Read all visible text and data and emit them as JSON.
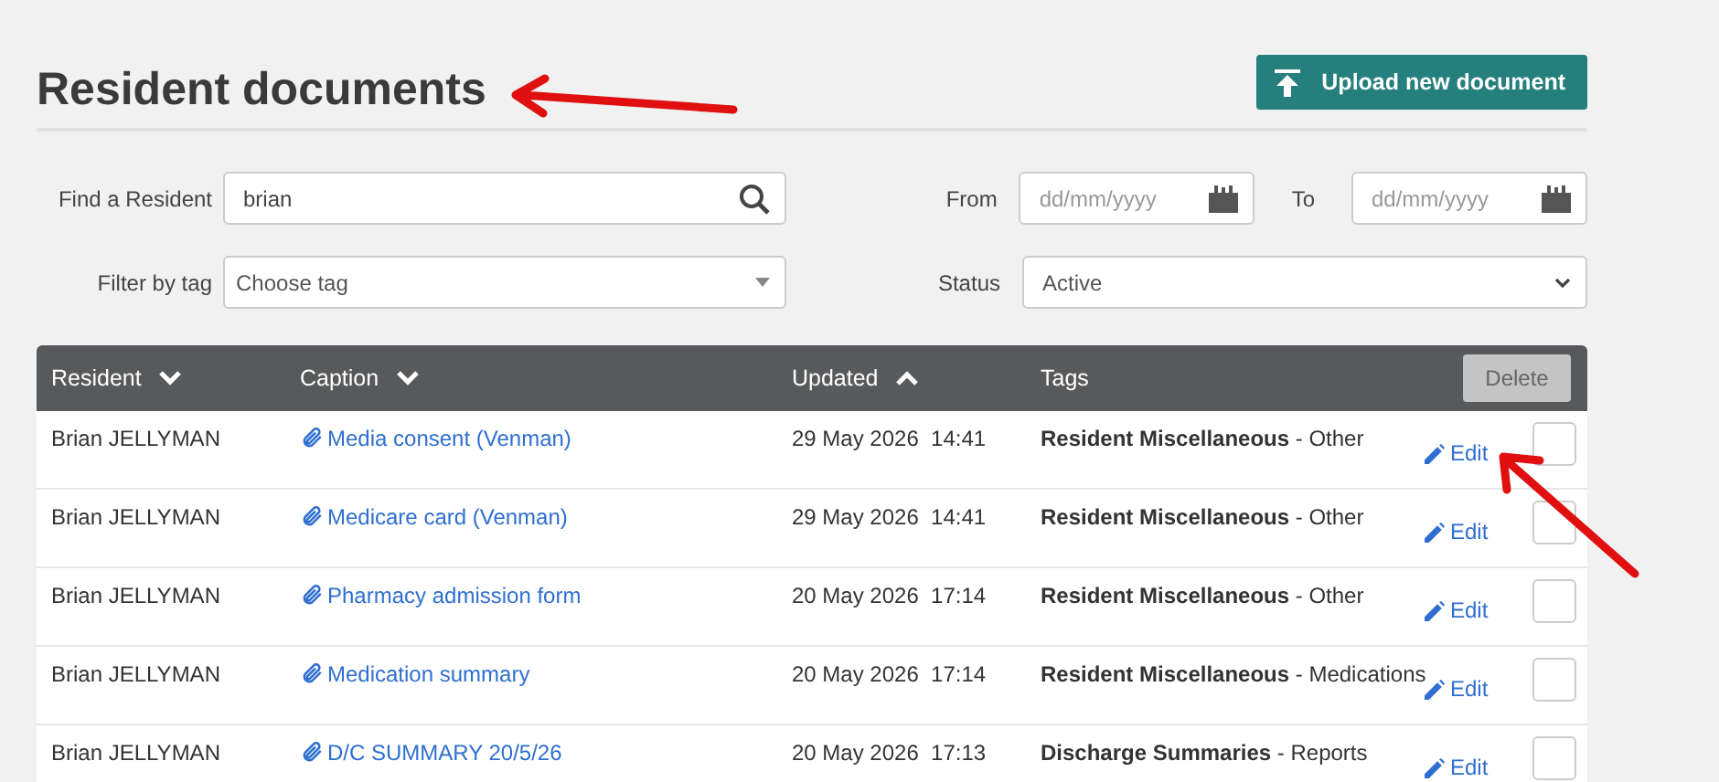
{
  "title": "Resident documents",
  "upload_button": {
    "label": "Upload new document"
  },
  "filters": {
    "find_resident": {
      "label": "Find a Resident",
      "value": "brian"
    },
    "tag": {
      "label": "Filter by tag",
      "placeholder": "Choose tag"
    },
    "from": {
      "label": "From",
      "placeholder": "dd/mm/yyyy"
    },
    "to": {
      "label": "To",
      "placeholder": "dd/mm/yyyy"
    },
    "status": {
      "label": "Status",
      "value": "Active"
    }
  },
  "table": {
    "columns": [
      {
        "label": "Resident",
        "sortable": true,
        "ascending": false
      },
      {
        "label": "Caption",
        "sortable": true,
        "ascending": false
      },
      {
        "label": "Updated",
        "sortable": true,
        "ascending": true
      },
      {
        "label": "Tags",
        "sortable": false
      }
    ],
    "delete_button": "Delete",
    "rows": [
      {
        "resident": "Brian JELLYMAN",
        "caption": "Media consent (Venman)",
        "updated": "29 May 2026  14:41",
        "tags": "**Resident Miscellaneous** - Other",
        "edit": "Edit",
        "checked": false
      },
      {
        "resident": "Brian JELLYMAN",
        "caption": "Medicare card (Venman)",
        "updated": "29 May 2026  14:41",
        "tags": "**Resident Miscellaneous** - Other",
        "edit": "Edit",
        "checked": false
      },
      {
        "resident": "Brian JELLYMAN",
        "caption": "Pharmacy admission form",
        "updated": "20 May 2026  17:14",
        "tags": "**Resident Miscellaneous** - Other",
        "edit": "Edit",
        "checked": false
      },
      {
        "resident": "Brian JELLYMAN",
        "caption": "Medication summary",
        "updated": "20 May 2026  17:14",
        "tags": "**Resident Miscellaneous** - Medications",
        "edit": "Edit",
        "checked": false
      },
      {
        "resident": "Brian JELLYMAN",
        "caption": "D/C SUMMARY 20/5/26",
        "updated": "20 May 2026  17:13",
        "tags": "**Discharge Summaries** - Reports",
        "edit": "Edit",
        "checked": false
      }
    ]
  }
}
